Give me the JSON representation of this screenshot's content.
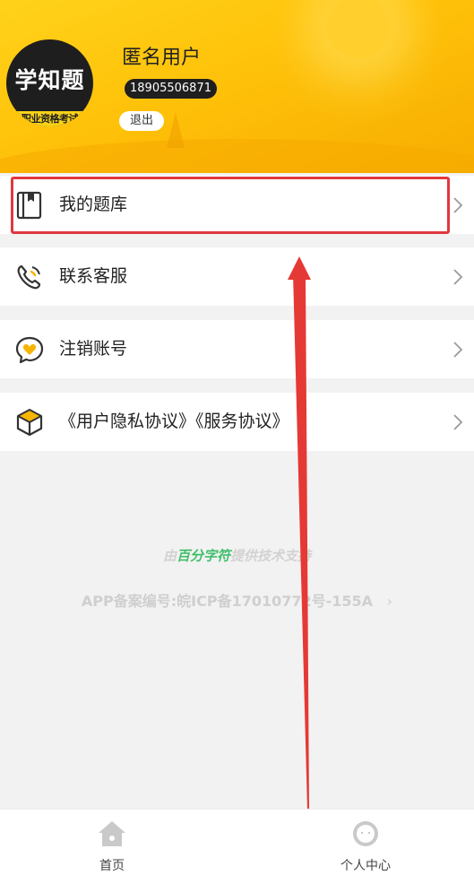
{
  "profile": {
    "logo_main": "学知题",
    "logo_sub": "职业资格考试",
    "username": "匿名用户",
    "phone": "18905506871",
    "logout_label": "退出"
  },
  "menu": [
    {
      "label": "我的题库",
      "icon": "question-bank-icon"
    },
    {
      "label": "联系客服",
      "icon": "phone-icon"
    },
    {
      "label": "注销账号",
      "icon": "heart-bubble-icon"
    },
    {
      "label": "《用户隐私协议》《服务协议》",
      "icon": "package-icon"
    }
  ],
  "footer": {
    "credit_prefix": "由",
    "credit_brand": "百分字符",
    "credit_suffix": "提供技术支持",
    "icp": "APP备案编号:皖ICP备17010772号-155A"
  },
  "tabbar": {
    "home_label": "首页",
    "profile_label": "个人中心"
  },
  "colors": {
    "header": "#ffc20a",
    "highlight": "#e0383e",
    "annotation_arrow": "#e53935"
  }
}
